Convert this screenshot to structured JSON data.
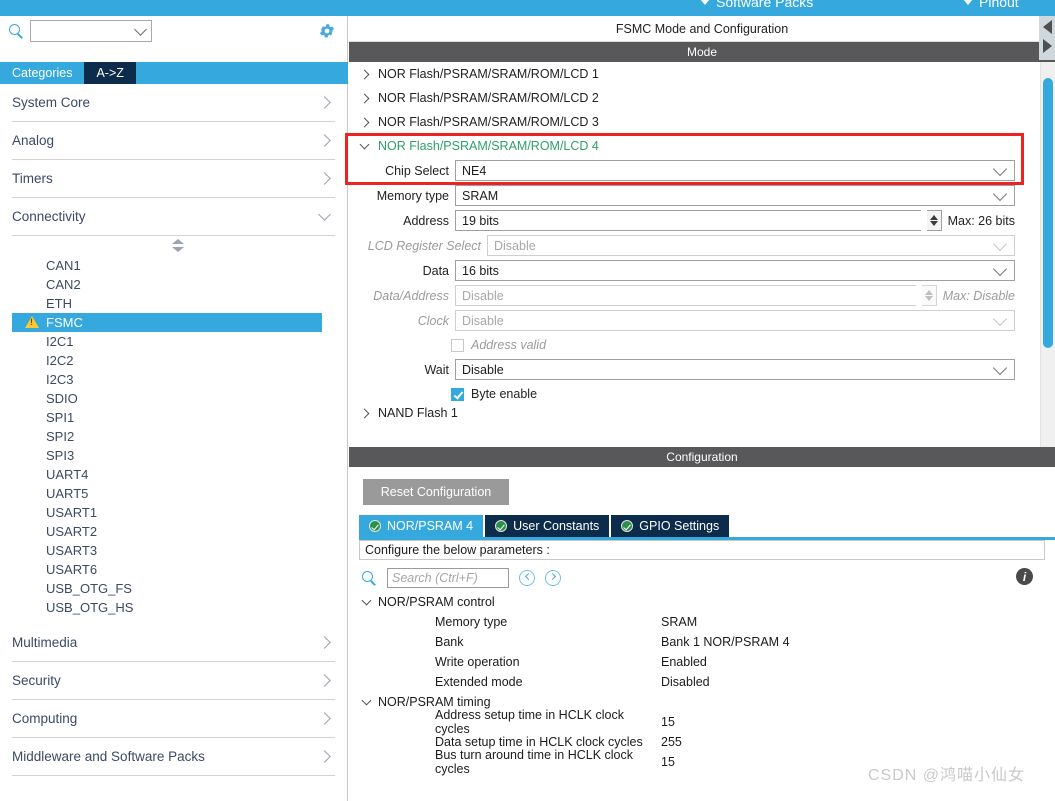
{
  "menu": {
    "items": [
      {
        "label": "Software Packs",
        "icon": "chevron-down-icon"
      },
      {
        "label": "Pinout",
        "icon": "chevron-down-icon"
      }
    ]
  },
  "sidebar": {
    "search": {
      "value": "",
      "placeholder": ""
    },
    "gear_icon": "gear-icon",
    "search_icon": "search-icon",
    "tabs": [
      {
        "label": "Categories",
        "active": true
      },
      {
        "label": "A->Z",
        "active": false
      }
    ],
    "categories": [
      {
        "label": "System Core",
        "expanded": false
      },
      {
        "label": "Analog",
        "expanded": false
      },
      {
        "label": "Timers",
        "expanded": false
      },
      {
        "label": "Connectivity",
        "expanded": true
      }
    ],
    "peripherals": [
      {
        "label": "CAN1",
        "selected": false,
        "warning": false
      },
      {
        "label": "CAN2",
        "selected": false,
        "warning": false
      },
      {
        "label": "ETH",
        "selected": false,
        "warning": false
      },
      {
        "label": "FSMC",
        "selected": true,
        "warning": true
      },
      {
        "label": "I2C1",
        "selected": false,
        "warning": false
      },
      {
        "label": "I2C2",
        "selected": false,
        "warning": false
      },
      {
        "label": "I2C3",
        "selected": false,
        "warning": false
      },
      {
        "label": "SDIO",
        "selected": false,
        "warning": false
      },
      {
        "label": "SPI1",
        "selected": false,
        "warning": false
      },
      {
        "label": "SPI2",
        "selected": false,
        "warning": false
      },
      {
        "label": "SPI3",
        "selected": false,
        "warning": false
      },
      {
        "label": "UART4",
        "selected": false,
        "warning": false
      },
      {
        "label": "UART5",
        "selected": false,
        "warning": false
      },
      {
        "label": "USART1",
        "selected": false,
        "warning": false
      },
      {
        "label": "USART2",
        "selected": false,
        "warning": false
      },
      {
        "label": "USART3",
        "selected": false,
        "warning": false
      },
      {
        "label": "USART6",
        "selected": false,
        "warning": false
      },
      {
        "label": "USB_OTG_FS",
        "selected": false,
        "warning": false
      },
      {
        "label": "USB_OTG_HS",
        "selected": false,
        "warning": false
      }
    ],
    "categories_bottom": [
      {
        "label": "Multimedia",
        "expanded": false
      },
      {
        "label": "Security",
        "expanded": false
      },
      {
        "label": "Computing",
        "expanded": false
      },
      {
        "label": "Middleware and Software Packs",
        "expanded": false
      }
    ]
  },
  "right": {
    "panel_title": "FSMC Mode and Configuration",
    "mode_band": "Mode",
    "config_band": "Configuration",
    "mode_tree": [
      {
        "label": "NOR Flash/PSRAM/SRAM/ROM/LCD 1",
        "expanded": false
      },
      {
        "label": "NOR Flash/PSRAM/SRAM/ROM/LCD 2",
        "expanded": false
      },
      {
        "label": "NOR Flash/PSRAM/SRAM/ROM/LCD 3",
        "expanded": false
      },
      {
        "label": "NOR Flash/PSRAM/SRAM/ROM/LCD 4",
        "expanded": true
      }
    ],
    "mode_tree_tail": {
      "label": "NAND Flash 1",
      "expanded": false
    },
    "fields": {
      "chip_select": {
        "label": "Chip Select",
        "value": "NE4",
        "disabled": false
      },
      "memory_type": {
        "label": "Memory type",
        "value": "SRAM",
        "disabled": false
      },
      "address": {
        "label": "Address",
        "value": "19 bits",
        "max": "Max: 26 bits",
        "disabled": false
      },
      "lcd_register_select": {
        "label": "LCD Register Select",
        "value": "Disable",
        "disabled": true
      },
      "data": {
        "label": "Data",
        "value": "16 bits",
        "disabled": false
      },
      "data_address": {
        "label": "Data/Address",
        "value": "Disable",
        "max": "Max: Disable",
        "disabled": true
      },
      "clock": {
        "label": "Clock",
        "value": "Disable",
        "disabled": true
      },
      "address_valid": {
        "label": "Address valid",
        "checked": false,
        "disabled": true
      },
      "wait": {
        "label": "Wait",
        "value": "Disable",
        "disabled": false
      },
      "byte_enable": {
        "label": "Byte enable",
        "checked": true,
        "disabled": false
      }
    }
  },
  "config": {
    "reset_button": "Reset Configuration",
    "tabs": [
      {
        "label": "NOR/PSRAM 4",
        "active": true,
        "status": "ok"
      },
      {
        "label": "User Constants",
        "active": false,
        "status": "ok"
      },
      {
        "label": "GPIO Settings",
        "active": false,
        "status": "ok"
      }
    ],
    "hint": "Configure the below parameters :",
    "search": {
      "value": "",
      "placeholder": "Search (Ctrl+F)"
    },
    "nav": {
      "prev_icon": "prev-circle-icon",
      "next_icon": "next-circle-icon"
    },
    "info_icon": "info-icon",
    "groups": [
      {
        "name": "NOR/PSRAM control",
        "rows": [
          {
            "name": "Memory type",
            "value": "SRAM"
          },
          {
            "name": "Bank",
            "value": "Bank 1 NOR/PSRAM 4"
          },
          {
            "name": "Write operation",
            "value": "Enabled"
          },
          {
            "name": "Extended mode",
            "value": "Disabled"
          }
        ]
      },
      {
        "name": "NOR/PSRAM timing",
        "rows": [
          {
            "name": "Address setup time in HCLK clock cycles",
            "value": "15"
          },
          {
            "name": "Data setup time in HCLK clock cycles",
            "value": "255"
          },
          {
            "name": "Bus turn around time in HCLK clock cycles",
            "value": "15"
          }
        ]
      }
    ]
  },
  "watermark": "CSDN @鸿喵小仙女",
  "colors": {
    "accent": "#35a9dd",
    "tab_inactive": "#0d2c4b",
    "band": "#58585a",
    "highlight_box": "#ef2222",
    "warning": "#ffc832",
    "expanded_text": "#2ea06a"
  }
}
